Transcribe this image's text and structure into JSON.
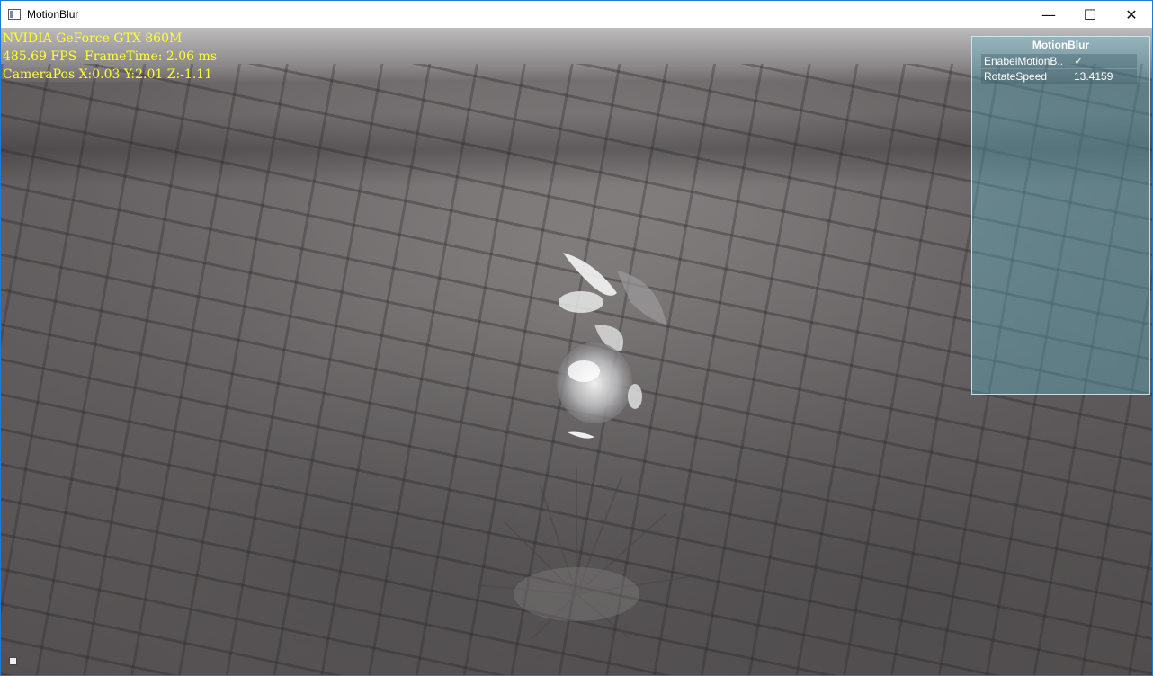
{
  "window": {
    "title": "MotionBlur",
    "controls": {
      "minimize": "—",
      "maximize": "☐",
      "close": "✕"
    }
  },
  "stats": {
    "gpu": "NVIDIA GeForce GTX 860M",
    "fps": "485.69 FPS  FrameTime: 2.06 ms",
    "camera": "CameraPos X:0.03 Y:2.01 Z:-1.11"
  },
  "panel": {
    "title": "MotionBlur",
    "rows": [
      {
        "name": "EnabelMotionB..",
        "value": "✓"
      },
      {
        "name": "RotateSpeed",
        "value": "13.4159"
      }
    ]
  },
  "colors": {
    "overlay_text": "#ffff2e",
    "panel_bg": "#60bed2",
    "window_border": "#1c7bd6"
  },
  "icons": {
    "app": "app-icon",
    "corner": "resize-grip-icon"
  }
}
